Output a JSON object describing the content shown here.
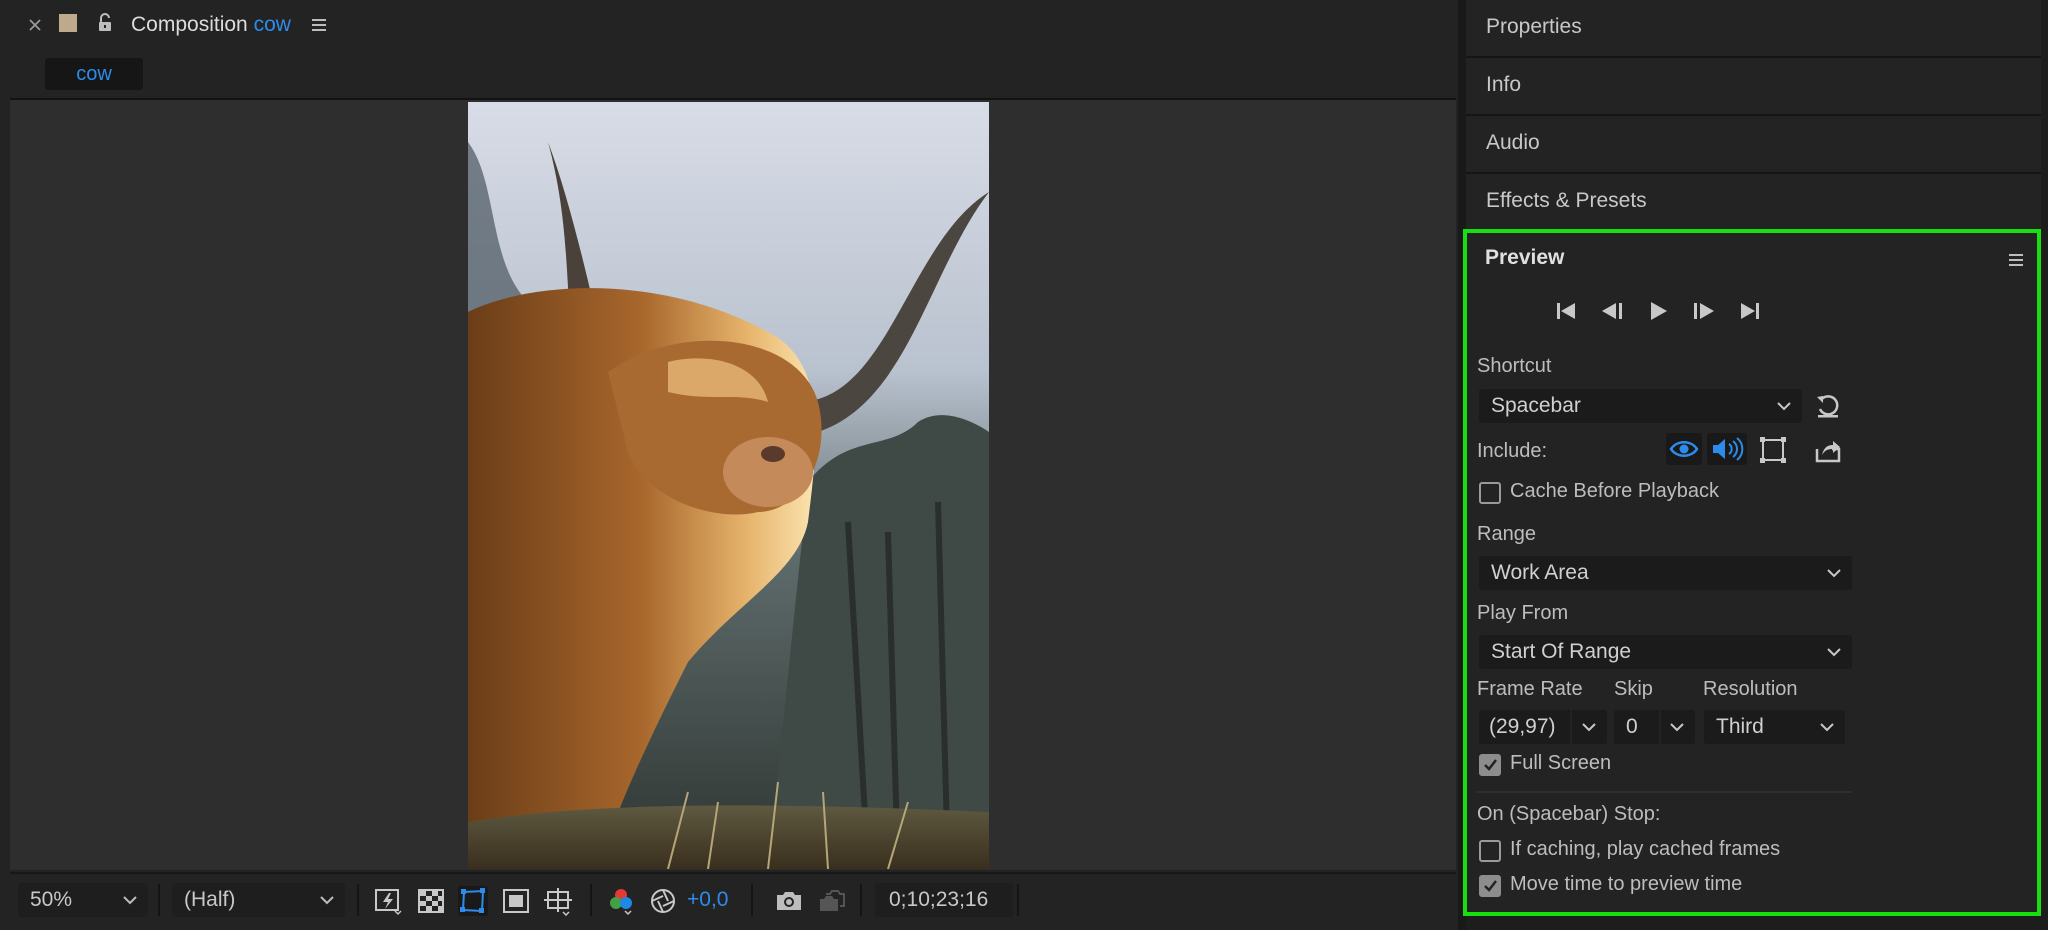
{
  "composition": {
    "panel_title": "Composition",
    "comp_name": "cow",
    "tab_label": "cow",
    "footer": {
      "zoom": "50%",
      "resolution": "(Half)",
      "exposure": "+0,0",
      "timecode": "0;10;23;16"
    }
  },
  "panels": {
    "properties": "Properties",
    "info": "Info",
    "audio": "Audio",
    "effects": "Effects & Presets"
  },
  "preview": {
    "title": "Preview",
    "shortcut_label": "Shortcut",
    "shortcut_value": "Spacebar",
    "include_label": "Include:",
    "cache_before_playback": "Cache Before Playback",
    "range_label": "Range",
    "range_value": "Work Area",
    "play_from_label": "Play From",
    "play_from_value": "Start Of Range",
    "frame_rate_label": "Frame Rate",
    "frame_rate_value": "(29,97)",
    "skip_label": "Skip",
    "skip_value": "0",
    "resolution_label": "Resolution",
    "resolution_value": "Third",
    "full_screen": "Full Screen",
    "full_screen_checked": true,
    "stop_label": "On (Spacebar) Stop:",
    "if_caching": "If caching, play cached frames",
    "if_caching_checked": false,
    "move_time": "Move time to preview time",
    "move_time_checked": true,
    "cache_checked": false
  },
  "colors": {
    "accent_blue": "#2d8ceb",
    "highlight_border": "#18e010",
    "panel_bg": "#232323",
    "viewer_bg": "#2e2e2e"
  }
}
